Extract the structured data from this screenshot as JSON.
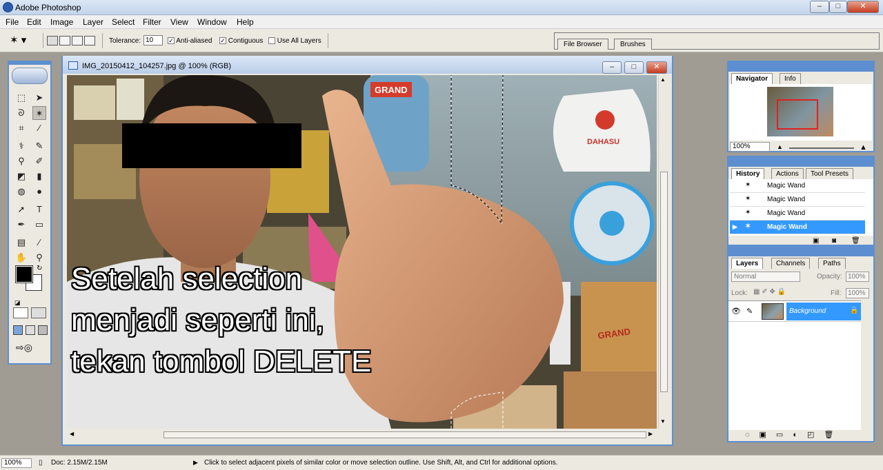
{
  "app": {
    "title": "Adobe Photoshop",
    "min": "–",
    "max": "□",
    "close": "✕"
  },
  "menu": [
    "File",
    "Edit",
    "Image",
    "Layer",
    "Select",
    "Filter",
    "View",
    "Window",
    "Help"
  ],
  "options": {
    "tolerance_label": "Tolerance:",
    "tolerance_value": "10",
    "anti_aliased_label": "Anti-aliased",
    "anti_aliased": true,
    "contiguous_label": "Contiguous",
    "contiguous": true,
    "use_all_layers_label": "Use All Layers",
    "use_all_layers": false
  },
  "wells": [
    "File Browser",
    "Brushes"
  ],
  "document": {
    "title": "IMG_20150412_104257.jpg @ 100% (RGB)",
    "caption_lines": [
      "Setelah selection",
      "menjadi seperti ini,",
      "tekan tombol DELETE"
    ],
    "photo_labels": {
      "grand_top": "GRAND",
      "bag": "DAHASU",
      "box": "GRAND"
    }
  },
  "navigator": {
    "tabs": [
      "Navigator",
      "Info"
    ],
    "zoom": "100%"
  },
  "history": {
    "tabs": [
      "History",
      "Actions",
      "Tool Presets"
    ],
    "items": [
      "Magic Wand",
      "Magic Wand",
      "Magic Wand",
      "Magic Wand"
    ],
    "selected_index": 3
  },
  "layers": {
    "tabs": [
      "Layers",
      "Channels",
      "Paths"
    ],
    "blend_mode": "Normal",
    "opacity_label": "Opacity:",
    "opacity": "100%",
    "lock_label": "Lock:",
    "fill_label": "Fill:",
    "fill": "100%",
    "items": [
      {
        "name": "Background",
        "visible": true,
        "locked": true
      }
    ]
  },
  "status": {
    "zoom": "100%",
    "doc": "Doc: 2.15M/2.15M",
    "hint": "Click to select adjacent pixels of similar color or move selection outline.  Use Shift, Alt, and Ctrl for additional options."
  },
  "colors": {
    "accent": "#5d8fd0",
    "selection": "#3399ff",
    "foreground": "#000000",
    "background": "#ffffff"
  }
}
